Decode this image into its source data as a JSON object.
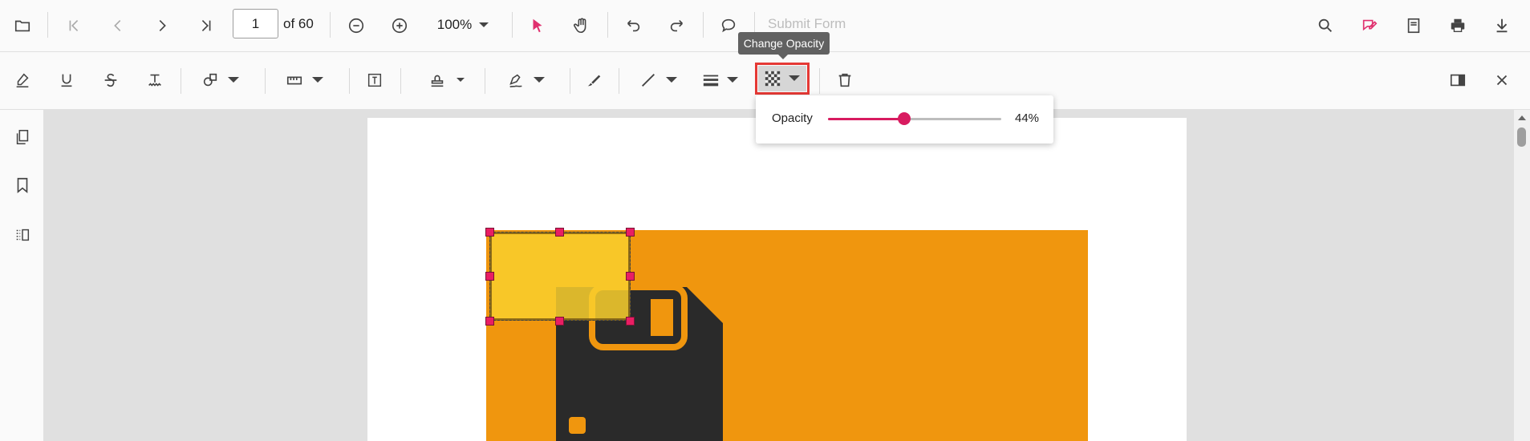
{
  "toolbar": {
    "page_number": "1",
    "page_count_label": "of 60",
    "zoom_label": "100%",
    "submit_form_label": "Submit Form"
  },
  "tooltip": {
    "text": "Change Opacity"
  },
  "opacity_popup": {
    "label": "Opacity",
    "value_label": "44%",
    "value": 44
  },
  "colors": {
    "accent": "#d81b60",
    "selection_handle": "#e91e63",
    "highlight_border": "#e53935",
    "page_orange": "#f0960e",
    "rectangle_fill": "#f9cf2e",
    "floppy_icon": "#2a2a2a"
  },
  "icons": {
    "toolbar": [
      "open-file-icon",
      "first-page-icon",
      "previous-page-icon",
      "next-page-icon",
      "last-page-icon",
      "zoom-out-icon",
      "zoom-in-icon",
      "chevron-down-icon",
      "select-pointer-icon",
      "pan-hand-icon",
      "undo-icon",
      "redo-icon",
      "comment-icon",
      "search-icon",
      "edit-annotation-icon",
      "form-designer-icon",
      "print-icon",
      "download-icon"
    ],
    "annotation": [
      "highlight-icon",
      "underline-icon",
      "strikethrough-icon",
      "squiggly-icon",
      "shapes-icon",
      "measure-icon",
      "free-text-icon",
      "stamp-icon",
      "signature-icon",
      "ink-icon",
      "line-icon",
      "stroke-thickness-icon",
      "opacity-icon",
      "delete-icon",
      "comment-panel-icon",
      "close-icon"
    ],
    "sidebar": [
      "page-thumbnails-icon",
      "bookmark-icon",
      "organize-pages-icon"
    ]
  }
}
